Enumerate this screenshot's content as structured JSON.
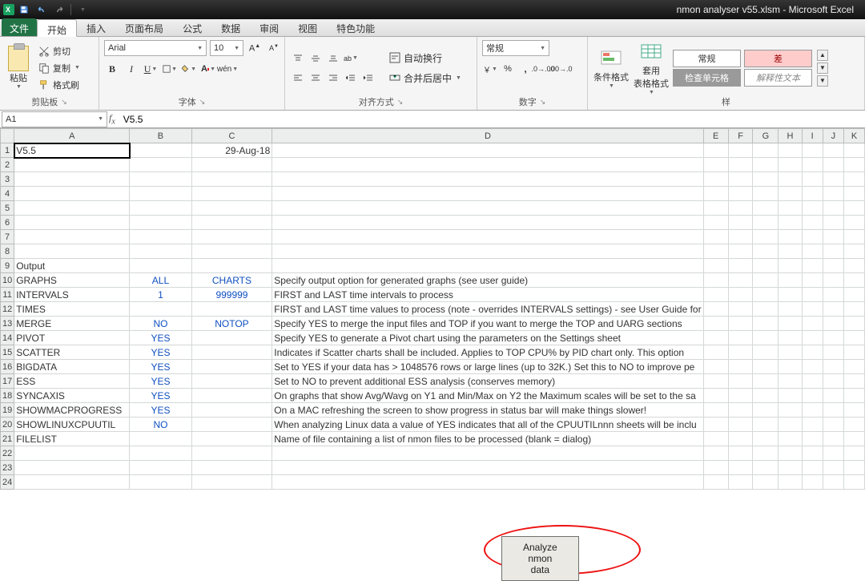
{
  "title_bar": {
    "window_title": "nmon analyser v55.xlsm - Microsoft Excel"
  },
  "tabs": {
    "file": "文件",
    "active": "开始",
    "others": [
      "插入",
      "页面布局",
      "公式",
      "数据",
      "审阅",
      "视图",
      "特色功能"
    ]
  },
  "ribbon": {
    "clipboard": {
      "paste": "粘贴",
      "cut": "剪切",
      "copy": "复制",
      "format_painter": "格式刷",
      "group": "剪贴板"
    },
    "font": {
      "name": "Arial",
      "size": "10",
      "group": "字体"
    },
    "alignment": {
      "wrap": "自动换行",
      "merge": "合并后居中",
      "group": "对齐方式"
    },
    "number": {
      "format": "常规",
      "group": "数字"
    },
    "styles": {
      "cond_fmt": "条件格式",
      "format_table": "套用\n表格格式",
      "cell1": "常规",
      "cell2": "差",
      "cell3": "检查单元格",
      "cell4": "解释性文本",
      "group": "样"
    }
  },
  "namebox": "A1",
  "formula_value": "V5.5",
  "columns": [
    {
      "letter": "A",
      "width": 156
    },
    {
      "letter": "B",
      "width": 160
    },
    {
      "letter": "C",
      "width": 168
    },
    {
      "letter": "D",
      "width": 80
    },
    {
      "letter": "E",
      "width": 70
    },
    {
      "letter": "F",
      "width": 70
    },
    {
      "letter": "G",
      "width": 70
    },
    {
      "letter": "H",
      "width": 64
    },
    {
      "letter": "I",
      "width": 62
    },
    {
      "letter": "J",
      "width": 60
    },
    {
      "letter": "K",
      "width": 56
    }
  ],
  "sheet_button": "Analyze nmon data",
  "rows": [
    {
      "r": 1,
      "cells": {
        "A": "V5.5",
        "C": "29-Aug-18"
      },
      "classes": {
        "A": "selected",
        "C": "right"
      }
    },
    {
      "r": 2
    },
    {
      "r": 3
    },
    {
      "r": 4
    },
    {
      "r": 5
    },
    {
      "r": 6
    },
    {
      "r": 7
    },
    {
      "r": 8
    },
    {
      "r": 9,
      "cells": {
        "A": "Output"
      },
      "classes": {
        "A": "bold"
      }
    },
    {
      "r": 10,
      "cells": {
        "A": "GRAPHS",
        "B": "ALL",
        "C": "CHARTS",
        "D": "Specify output option for generated graphs (see user guide)"
      },
      "classes": {
        "B": "blue center",
        "C": "blue center"
      }
    },
    {
      "r": 11,
      "cells": {
        "A": "INTERVALS",
        "B": "1",
        "C": "999999",
        "D": "FIRST and LAST time intervals to process"
      },
      "classes": {
        "B": "blue center",
        "C": "blue center"
      }
    },
    {
      "r": 12,
      "cells": {
        "A": "TIMES",
        "D": "FIRST and LAST time values to process (note - overrides INTERVALS settings) - see User Guide for"
      }
    },
    {
      "r": 13,
      "cells": {
        "A": "MERGE",
        "B": "NO",
        "C": "NOTOP",
        "D": "Specify YES to merge the input files and TOP if you want to merge the TOP and UARG sections"
      },
      "classes": {
        "B": "blue center",
        "C": "blue center"
      }
    },
    {
      "r": 14,
      "cells": {
        "A": "PIVOT",
        "B": "YES",
        "D": "Specify YES to generate a Pivot chart using the parameters on the Settings sheet"
      },
      "classes": {
        "B": "blue center"
      }
    },
    {
      "r": 15,
      "cells": {
        "A": "SCATTER",
        "B": "YES",
        "D": "Indicates if Scatter charts shall be included.  Applies to TOP CPU% by PID chart only.  This option"
      },
      "classes": {
        "B": "blue center"
      }
    },
    {
      "r": 16,
      "cells": {
        "A": "BIGDATA",
        "B": "YES",
        "D": "Set to YES if your data has > 1048576 rows or large lines (up to 32K.)  Set this to NO to improve pe"
      },
      "classes": {
        "B": "blue center"
      }
    },
    {
      "r": 17,
      "cells": {
        "A": "ESS",
        "B": "YES",
        "D": "Set to NO to prevent additional ESS analysis (conserves memory)"
      },
      "classes": {
        "B": "blue center"
      }
    },
    {
      "r": 18,
      "cells": {
        "A": "SYNCAXIS",
        "B": "YES",
        "D": "On graphs that show Avg/Wavg on Y1 and Min/Max on Y2 the Maximum scales will be set to the sa"
      },
      "classes": {
        "B": "blue center"
      }
    },
    {
      "r": 19,
      "cells": {
        "A": "SHOWMACPROGRESS",
        "B": "YES",
        "D": "On a MAC refreshing the screen to show progress in status bar will make things slower!"
      },
      "classes": {
        "B": "blue center"
      }
    },
    {
      "r": 20,
      "cells": {
        "A": "SHOWLINUXCPUUTIL",
        "B": "NO",
        "D": "When analyzing Linux data a value of YES indicates that all of the CPUUTILnnn sheets will be inclu"
      },
      "classes": {
        "B": "blue center"
      }
    },
    {
      "r": 21,
      "cells": {
        "A": "FILELIST",
        "D": "Name of file containing a list of nmon files to be processed (blank = dialog)"
      }
    },
    {
      "r": 22
    },
    {
      "r": 23
    },
    {
      "r": 24
    }
  ]
}
